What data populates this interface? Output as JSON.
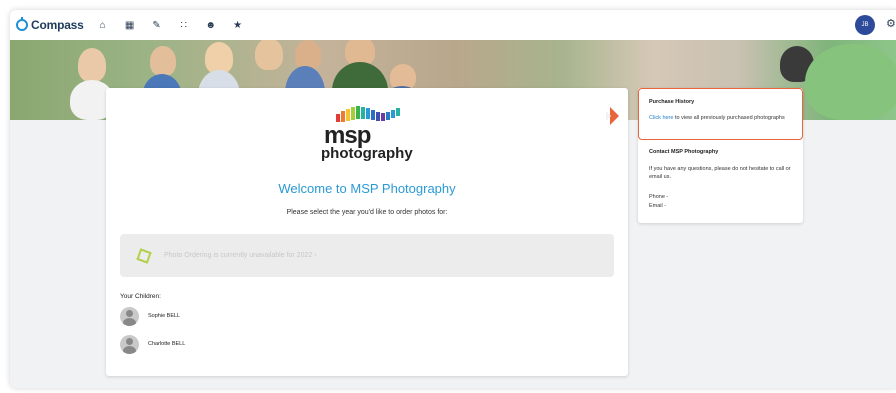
{
  "topbar": {
    "app_name": "Compass",
    "nav_icons": [
      "home-icon",
      "calendar-icon",
      "pencil-icon",
      "grid-icon",
      "people-icon",
      "star-icon"
    ],
    "avatar_initials": "JB"
  },
  "main": {
    "logo_word": "msp",
    "logo_sub": "photography",
    "welcome": "Welcome to MSP Photography",
    "select_year": "Please select the year you'd like to order photos for:",
    "unavailable": "Photo Ordering is currently unavailable for 2022 ›",
    "children_label": "Your Children:",
    "children": [
      {
        "name": "Sophie BELL"
      },
      {
        "name": "Charlotte BELL"
      }
    ]
  },
  "side": {
    "purchase_heading": "Purchase History",
    "purchase_link": "Click here",
    "purchase_text": " to view all previously purchased photographs",
    "contact_heading": "Contact MSP Photography",
    "contact_text": "If you have any questions, please do not hesitate to call or email us.",
    "phone": "Phone -",
    "email": "Email -"
  },
  "colors": {
    "accent_blue": "#2a9ad6",
    "highlight_orange": "#e8643b",
    "brand_navy": "#1f3a5c"
  }
}
